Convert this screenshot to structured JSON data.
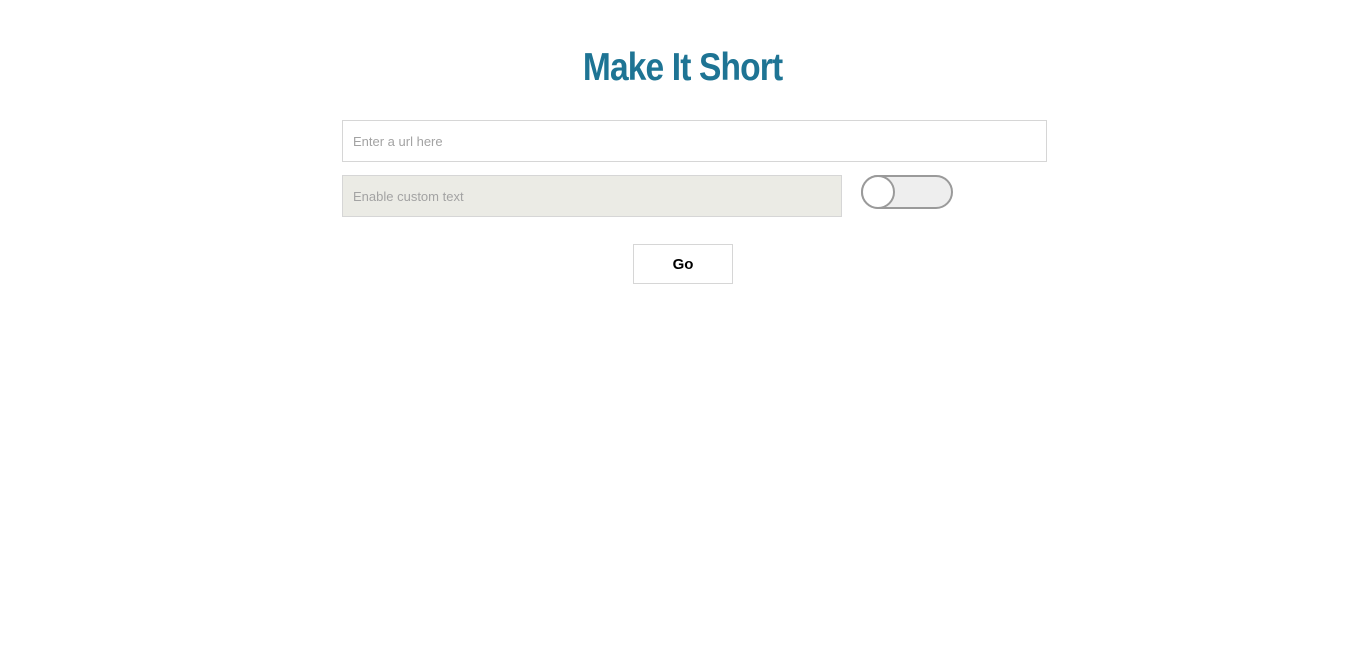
{
  "header": {
    "title": "Make It Short"
  },
  "form": {
    "url_input": {
      "value": "",
      "placeholder": "Enter a url here"
    },
    "custom_text_input": {
      "value": "",
      "placeholder": "Enable custom text",
      "enabled": false
    },
    "custom_text_toggle": {
      "on": false
    },
    "submit_label": "Go"
  },
  "colors": {
    "title": "#1e7494",
    "disabled_input_bg": "#ebebe5",
    "toggle_border": "#9a9a9a"
  }
}
